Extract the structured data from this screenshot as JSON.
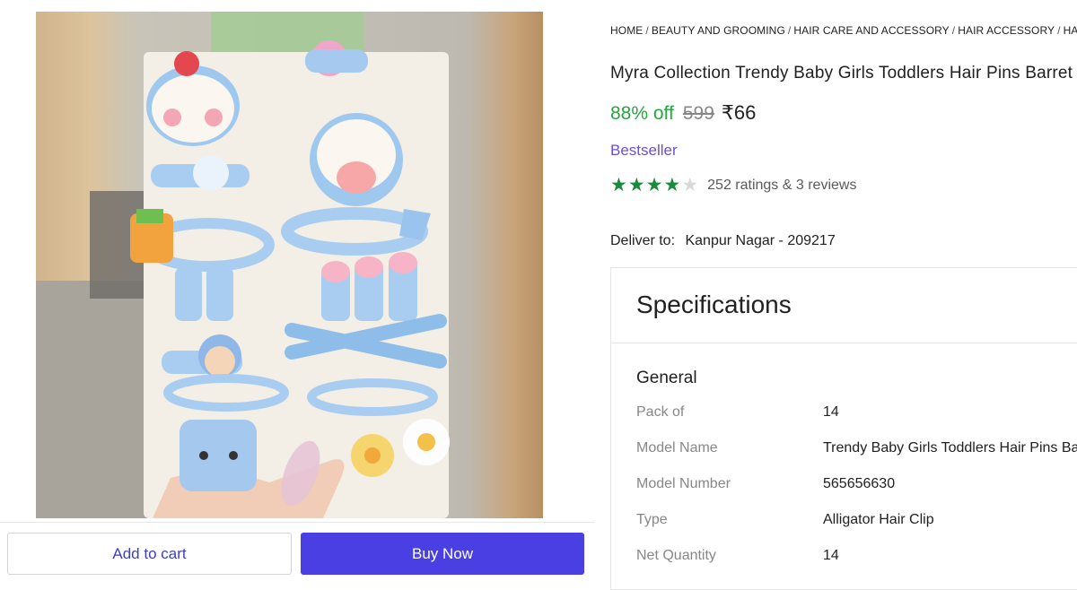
{
  "breadcrumb": [
    "HOME",
    "BEAUTY AND GROOMING",
    "HAIR CARE AND ACCESSORY",
    "HAIR ACCESSORY",
    "HAIR C"
  ],
  "product": {
    "title": "Myra Collection Trendy Baby Girls Toddlers Hair Pins Barret",
    "discount": "88% off",
    "mrp": "599",
    "price": "₹66",
    "badge": "Bestseller",
    "rating_stars": 4,
    "ratings_text": "252 ratings & 3 reviews"
  },
  "delivery": {
    "label": "Deliver to:",
    "location": "Kanpur Nagar - 209217"
  },
  "specifications": {
    "heading": "Specifications",
    "group": "General",
    "rows": [
      {
        "key": "Pack of",
        "value": "14"
      },
      {
        "key": "Model Name",
        "value": "Trendy Baby Girls Toddlers Hair Pins Bar"
      },
      {
        "key": "Model Number",
        "value": "565656630"
      },
      {
        "key": "Type",
        "value": "Alligator Hair Clip"
      },
      {
        "key": "Net Quantity",
        "value": "14"
      }
    ]
  },
  "actions": {
    "add_to_cart": "Add to cart",
    "buy_now": "Buy Now"
  },
  "colors": {
    "discount_green": "#26a541",
    "star_green": "#1b8a3d",
    "bestseller_purple": "#6c4fd0",
    "buy_now_bg": "#4a3fe2",
    "add_to_cart_text": "#3c3fbf"
  }
}
